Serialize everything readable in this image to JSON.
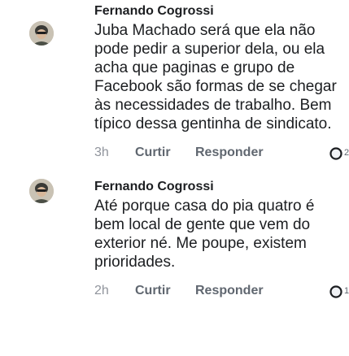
{
  "comments": [
    {
      "author": "Fernando Cogrossi",
      "text": "Juba Machado será que ela não pode pedir a superior dela, ou ela acha que paginas e grupo de Facebook são formas de se chegar às necessidades de trabalho. Bem típico dessa gentinha de sindicato.",
      "time": "3h",
      "like_label": "Curtir",
      "reply_label": "Responder",
      "reaction_icon": "reaction-icon",
      "reaction_count": "2"
    },
    {
      "author": "Fernando Cogrossi",
      "text": "Até porque casa do pia quatro é bem local de gente que vem do exterior né. Me poupe, existem prioridades.",
      "time": "2h",
      "like_label": "Curtir",
      "reply_label": "Responder",
      "reaction_icon": "reaction-icon",
      "reaction_count": "1"
    }
  ],
  "colors": {
    "text": "#1c1e21",
    "secondary": "#606770",
    "background": "#ffffff"
  }
}
